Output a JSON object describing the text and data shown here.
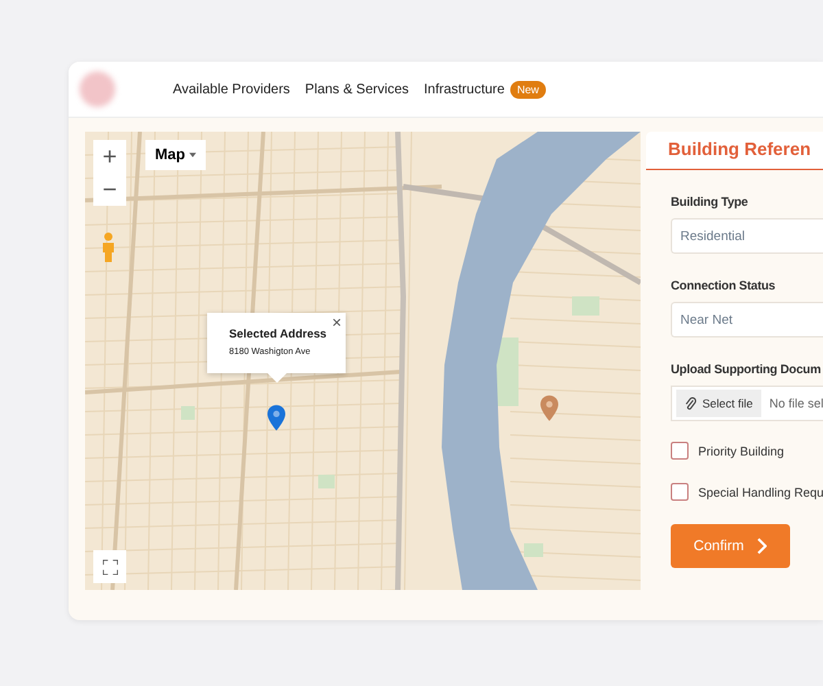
{
  "header": {
    "nav": [
      {
        "label": "Available Providers"
      },
      {
        "label": "Plans & Services"
      },
      {
        "label": "Infrastructure",
        "badge": "New"
      }
    ]
  },
  "map": {
    "zoom_in": "+",
    "zoom_out": "−",
    "type_button": "Map",
    "popup": {
      "close": "×",
      "title": "Selected Address",
      "address": "8180 Washigton Ave"
    }
  },
  "panel": {
    "tabs": [
      {
        "label": "Building Referen",
        "selected": true
      }
    ],
    "fields": [
      {
        "label": "Building Type",
        "value": "Residential"
      },
      {
        "label": "Connection Status",
        "value": "Near Net"
      }
    ],
    "upload": {
      "label": "Upload Supporting Docum",
      "button": "Select file",
      "status": "No file sel"
    },
    "checkboxes": [
      {
        "label": "Priority Building",
        "checked": false
      },
      {
        "label": "Special Handling Requ",
        "checked": false
      }
    ],
    "confirm": "Confirm"
  }
}
